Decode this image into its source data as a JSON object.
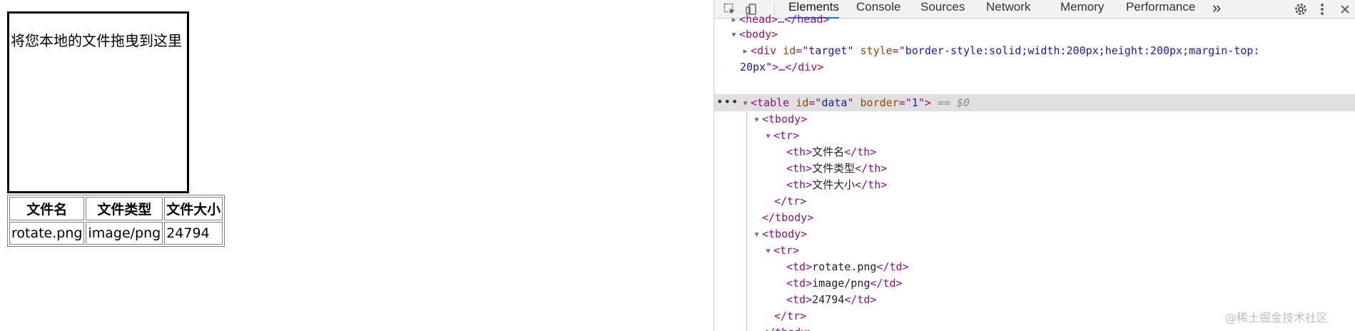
{
  "page": {
    "drop_target_text": "将您本地的文件拖曳到这里",
    "table": {
      "headers": [
        "文件名",
        "文件类型",
        "文件大小"
      ],
      "rows": [
        [
          "rotate.png",
          "image/png",
          "24794"
        ]
      ]
    }
  },
  "devtools": {
    "tabs": [
      "Elements",
      "Console",
      "Sources",
      "Network",
      "Memory",
      "Performance"
    ],
    "active_tab": "Elements",
    "more_tabs": "»",
    "icons": [
      "inspect-icon",
      "device-toolbar-icon",
      "gear-icon",
      "more-vert-icon",
      "close-icon"
    ],
    "dom": {
      "head_line": "<head>…</head>",
      "body_open": "<body>",
      "div_tag": "div",
      "div_id_attr": "id",
      "div_id_val": "target",
      "div_style_attr": "style",
      "div_style_val_1": "border-style:solid;width:200px;height:200px;margin-top:",
      "div_style_val_2": "20px",
      "div_rest": ">…</div>",
      "table_tag": "table",
      "table_id_attr": "id",
      "table_id_val": "data",
      "table_border_attr": "border",
      "table_border_val": "1",
      "selected_marker": "== $0",
      "tbody_open": "<tbody>",
      "tbody_close": "</tbody>",
      "tr_open": "<tr>",
      "tr_close": "</tr>",
      "th_cells": [
        "文件名",
        "文件类型",
        "文件大小"
      ],
      "td_cells": [
        "rotate.png",
        "image/png",
        "24794"
      ]
    },
    "colors": {
      "tag": "#881280",
      "attr_name": "#994500",
      "attr_value": "#1a1aa6",
      "selected_bg": "#e0e0e0",
      "active_tab_underline": "#1a73e8"
    }
  },
  "watermark": "@稀土掘金技术社区"
}
